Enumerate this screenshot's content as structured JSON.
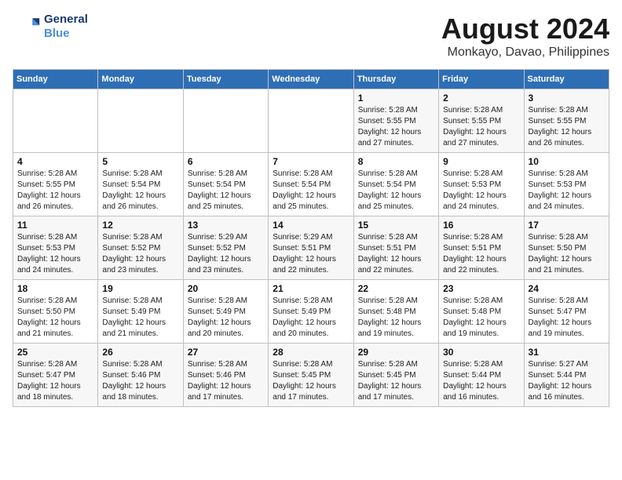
{
  "header": {
    "logo_line1": "General",
    "logo_line2": "Blue",
    "title": "August 2024",
    "subtitle": "Monkayo, Davao, Philippines"
  },
  "calendar": {
    "days_of_week": [
      "Sunday",
      "Monday",
      "Tuesday",
      "Wednesday",
      "Thursday",
      "Friday",
      "Saturday"
    ],
    "weeks": [
      [
        {
          "day": "",
          "info": ""
        },
        {
          "day": "",
          "info": ""
        },
        {
          "day": "",
          "info": ""
        },
        {
          "day": "",
          "info": ""
        },
        {
          "day": "1",
          "info": "Sunrise: 5:28 AM\nSunset: 5:55 PM\nDaylight: 12 hours\nand 27 minutes."
        },
        {
          "day": "2",
          "info": "Sunrise: 5:28 AM\nSunset: 5:55 PM\nDaylight: 12 hours\nand 27 minutes."
        },
        {
          "day": "3",
          "info": "Sunrise: 5:28 AM\nSunset: 5:55 PM\nDaylight: 12 hours\nand 26 minutes."
        }
      ],
      [
        {
          "day": "4",
          "info": "Sunrise: 5:28 AM\nSunset: 5:55 PM\nDaylight: 12 hours\nand 26 minutes."
        },
        {
          "day": "5",
          "info": "Sunrise: 5:28 AM\nSunset: 5:54 PM\nDaylight: 12 hours\nand 26 minutes."
        },
        {
          "day": "6",
          "info": "Sunrise: 5:28 AM\nSunset: 5:54 PM\nDaylight: 12 hours\nand 25 minutes."
        },
        {
          "day": "7",
          "info": "Sunrise: 5:28 AM\nSunset: 5:54 PM\nDaylight: 12 hours\nand 25 minutes."
        },
        {
          "day": "8",
          "info": "Sunrise: 5:28 AM\nSunset: 5:54 PM\nDaylight: 12 hours\nand 25 minutes."
        },
        {
          "day": "9",
          "info": "Sunrise: 5:28 AM\nSunset: 5:53 PM\nDaylight: 12 hours\nand 24 minutes."
        },
        {
          "day": "10",
          "info": "Sunrise: 5:28 AM\nSunset: 5:53 PM\nDaylight: 12 hours\nand 24 minutes."
        }
      ],
      [
        {
          "day": "11",
          "info": "Sunrise: 5:28 AM\nSunset: 5:53 PM\nDaylight: 12 hours\nand 24 minutes."
        },
        {
          "day": "12",
          "info": "Sunrise: 5:28 AM\nSunset: 5:52 PM\nDaylight: 12 hours\nand 23 minutes."
        },
        {
          "day": "13",
          "info": "Sunrise: 5:29 AM\nSunset: 5:52 PM\nDaylight: 12 hours\nand 23 minutes."
        },
        {
          "day": "14",
          "info": "Sunrise: 5:29 AM\nSunset: 5:51 PM\nDaylight: 12 hours\nand 22 minutes."
        },
        {
          "day": "15",
          "info": "Sunrise: 5:28 AM\nSunset: 5:51 PM\nDaylight: 12 hours\nand 22 minutes."
        },
        {
          "day": "16",
          "info": "Sunrise: 5:28 AM\nSunset: 5:51 PM\nDaylight: 12 hours\nand 22 minutes."
        },
        {
          "day": "17",
          "info": "Sunrise: 5:28 AM\nSunset: 5:50 PM\nDaylight: 12 hours\nand 21 minutes."
        }
      ],
      [
        {
          "day": "18",
          "info": "Sunrise: 5:28 AM\nSunset: 5:50 PM\nDaylight: 12 hours\nand 21 minutes."
        },
        {
          "day": "19",
          "info": "Sunrise: 5:28 AM\nSunset: 5:49 PM\nDaylight: 12 hours\nand 21 minutes."
        },
        {
          "day": "20",
          "info": "Sunrise: 5:28 AM\nSunset: 5:49 PM\nDaylight: 12 hours\nand 20 minutes."
        },
        {
          "day": "21",
          "info": "Sunrise: 5:28 AM\nSunset: 5:49 PM\nDaylight: 12 hours\nand 20 minutes."
        },
        {
          "day": "22",
          "info": "Sunrise: 5:28 AM\nSunset: 5:48 PM\nDaylight: 12 hours\nand 19 minutes."
        },
        {
          "day": "23",
          "info": "Sunrise: 5:28 AM\nSunset: 5:48 PM\nDaylight: 12 hours\nand 19 minutes."
        },
        {
          "day": "24",
          "info": "Sunrise: 5:28 AM\nSunset: 5:47 PM\nDaylight: 12 hours\nand 19 minutes."
        }
      ],
      [
        {
          "day": "25",
          "info": "Sunrise: 5:28 AM\nSunset: 5:47 PM\nDaylight: 12 hours\nand 18 minutes."
        },
        {
          "day": "26",
          "info": "Sunrise: 5:28 AM\nSunset: 5:46 PM\nDaylight: 12 hours\nand 18 minutes."
        },
        {
          "day": "27",
          "info": "Sunrise: 5:28 AM\nSunset: 5:46 PM\nDaylight: 12 hours\nand 17 minutes."
        },
        {
          "day": "28",
          "info": "Sunrise: 5:28 AM\nSunset: 5:45 PM\nDaylight: 12 hours\nand 17 minutes."
        },
        {
          "day": "29",
          "info": "Sunrise: 5:28 AM\nSunset: 5:45 PM\nDaylight: 12 hours\nand 17 minutes."
        },
        {
          "day": "30",
          "info": "Sunrise: 5:28 AM\nSunset: 5:44 PM\nDaylight: 12 hours\nand 16 minutes."
        },
        {
          "day": "31",
          "info": "Sunrise: 5:27 AM\nSunset: 5:44 PM\nDaylight: 12 hours\nand 16 minutes."
        }
      ]
    ]
  }
}
